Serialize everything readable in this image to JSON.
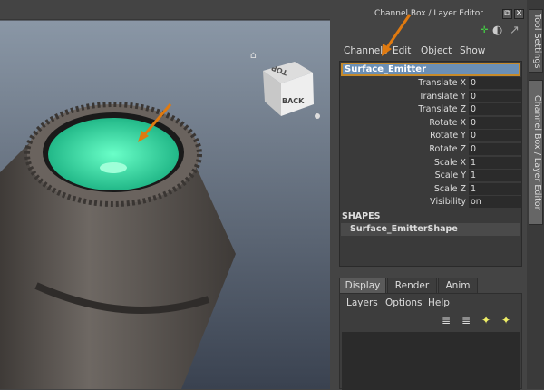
{
  "panel": {
    "title": "Channel Box / Layer Editor",
    "float_btn": "⧉",
    "close_btn": "✕",
    "menus": [
      "Channels",
      "Edit",
      "Object",
      "Show"
    ],
    "object": "Surface_Emitter",
    "channels": [
      {
        "name": "Translate X",
        "value": "0"
      },
      {
        "name": "Translate Y",
        "value": "0"
      },
      {
        "name": "Translate Z",
        "value": "0"
      },
      {
        "name": "Rotate X",
        "value": "0"
      },
      {
        "name": "Rotate Y",
        "value": "0"
      },
      {
        "name": "Rotate Z",
        "value": "0"
      },
      {
        "name": "Scale X",
        "value": "1"
      },
      {
        "name": "Scale Y",
        "value": "1"
      },
      {
        "name": "Scale Z",
        "value": "1"
      },
      {
        "name": "Visibility",
        "value": "on"
      }
    ],
    "shapes_header": "SHAPES",
    "shape": "Surface_EmitterShape",
    "tabs": [
      "Display",
      "Render",
      "Anim"
    ],
    "layer_menus": [
      "Layers",
      "Options",
      "Help"
    ]
  },
  "side_tabs": [
    "Tool Settings",
    "Channel Box / Layer Editor"
  ],
  "viewcube": {
    "top": "TOP",
    "back": "BACK"
  },
  "colors": {
    "selection": "#6b8fb5",
    "highlight": "#c68a2a",
    "emitter": "#3fe0a0",
    "arrow": "#e07a10"
  }
}
